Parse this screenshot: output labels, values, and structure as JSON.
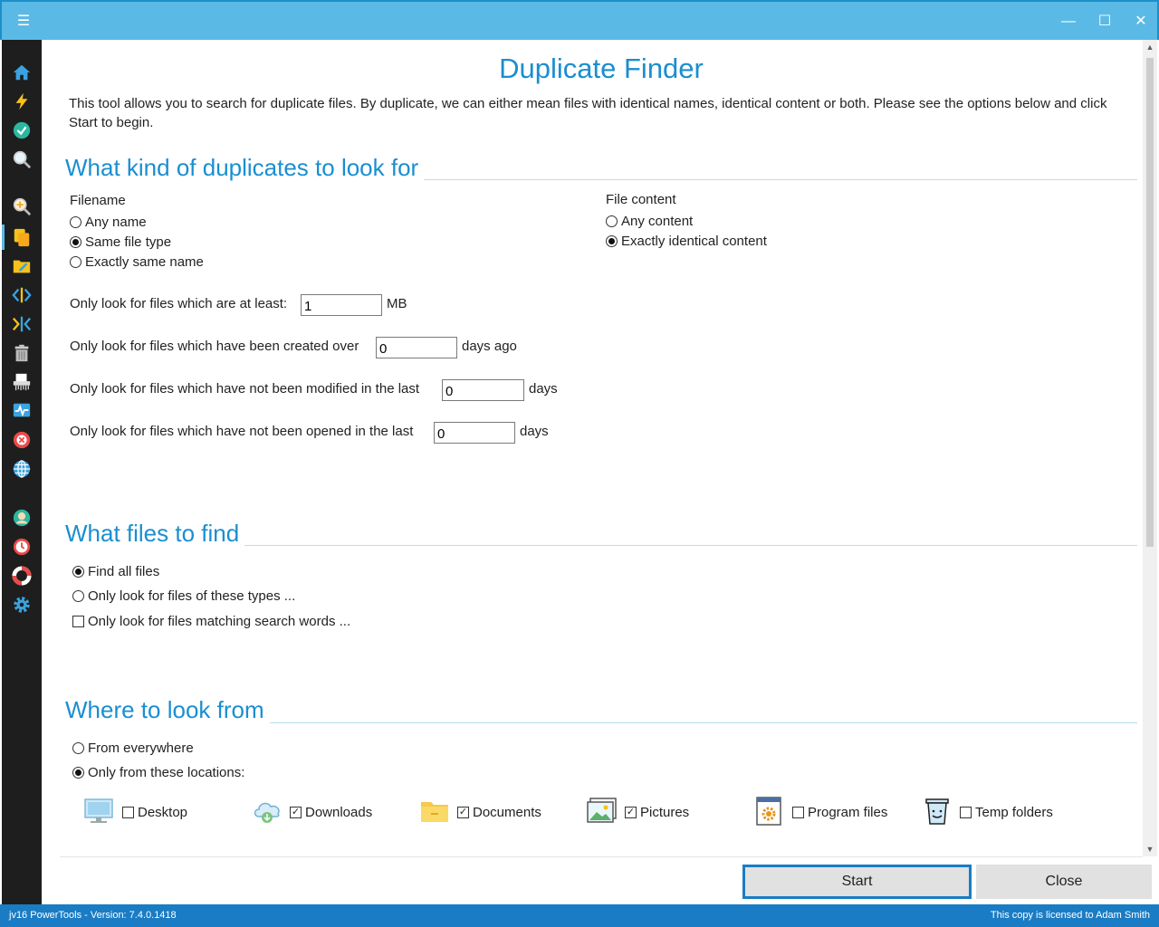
{
  "window": {
    "menu_icon": "hamburger-icon",
    "minimize_icon": "minimize-icon",
    "maximize_icon": "maximize-icon",
    "close_icon": "close-icon"
  },
  "sidebar": {
    "items": [
      {
        "name": "home-icon"
      },
      {
        "name": "lightning-icon"
      },
      {
        "name": "checkmark-icon"
      },
      {
        "name": "search-icon"
      },
      {
        "name": "zoom-in-icon"
      },
      {
        "name": "duplicate-files-icon",
        "active": true
      },
      {
        "name": "folder-edit-icon"
      },
      {
        "name": "code-split-icon"
      },
      {
        "name": "merge-icon"
      },
      {
        "name": "trash-icon"
      },
      {
        "name": "shredder-icon"
      },
      {
        "name": "monitor-pulse-icon"
      },
      {
        "name": "error-icon"
      },
      {
        "name": "globe-icon"
      },
      {
        "name": "user-icon"
      },
      {
        "name": "clock-icon"
      },
      {
        "name": "lifebuoy-icon"
      },
      {
        "name": "gear-icon"
      }
    ]
  },
  "page": {
    "title": "Duplicate Finder",
    "intro": "This tool allows you to search for duplicate files. By duplicate, we can either mean files with identical names, identical content or both. Please see the options below and click Start to begin."
  },
  "section1": {
    "heading": "What kind of duplicates to look for",
    "filename_label": "Filename",
    "filename_options": [
      "Any name",
      "Same file type",
      "Exactly same name"
    ],
    "filename_selected": 1,
    "content_label": "File content",
    "content_options": [
      "Any content",
      "Exactly identical content"
    ],
    "content_selected": 1,
    "size_label": "Only look for files which are at least:",
    "size_value": "1",
    "size_unit": "MB",
    "created_label": "Only look for files which have been created over",
    "created_value": "0",
    "created_unit": "days ago",
    "modified_label": "Only look for files which have not been modified in the last",
    "modified_value": "0",
    "modified_unit": "days",
    "opened_label": "Only look for files which have not been opened in the last",
    "opened_value": "0",
    "opened_unit": "days"
  },
  "section2": {
    "heading": "What files to find",
    "find_all": "Find all files",
    "only_types": "Only look for files of these types ...",
    "only_words": "Only look for files matching search words ..."
  },
  "section3": {
    "heading": "Where to look from",
    "everywhere": "From everywhere",
    "only_locations": "Only from these locations:",
    "locations": [
      {
        "label": "Desktop",
        "checked": false,
        "icon": "desktop-icon"
      },
      {
        "label": "Downloads",
        "checked": true,
        "icon": "cloud-download-icon"
      },
      {
        "label": "Documents",
        "checked": true,
        "icon": "folder-icon"
      },
      {
        "label": "Pictures",
        "checked": true,
        "icon": "pictures-icon"
      },
      {
        "label": "Program files",
        "checked": false,
        "icon": "program-files-icon"
      },
      {
        "label": "Temp folders",
        "checked": false,
        "icon": "recycle-bin-icon"
      }
    ]
  },
  "buttons": {
    "start": "Start",
    "close": "Close"
  },
  "status": {
    "left": "jv16 PowerTools - Version: 7.4.0.1418",
    "right": "This copy is licensed to Adam Smith"
  },
  "colors": {
    "accent": "#1a8ed1",
    "titlebar": "#5abae5",
    "statusbar": "#1a7cc4",
    "sidebar": "#1e1e1e"
  }
}
